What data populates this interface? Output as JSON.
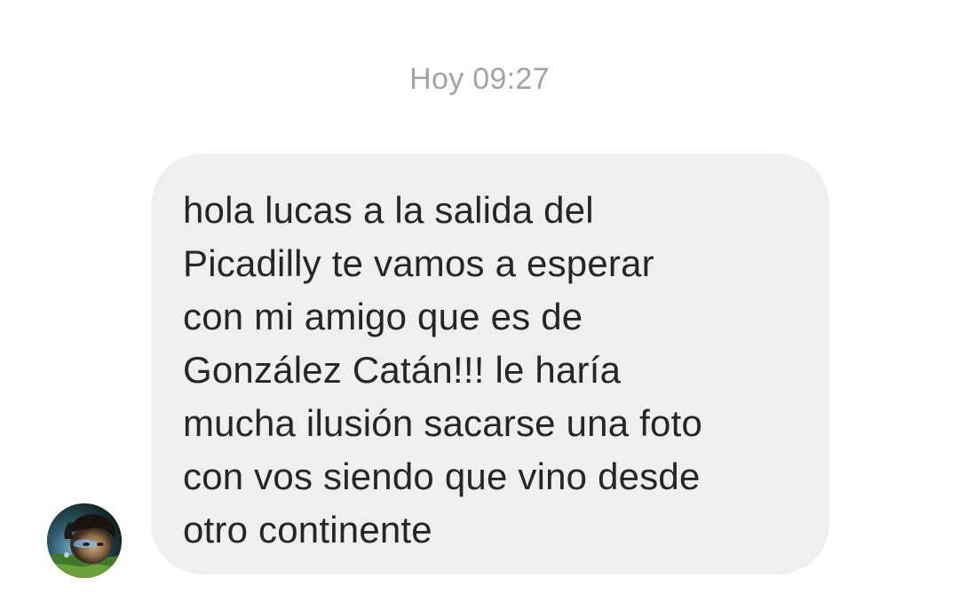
{
  "chat": {
    "timestamp": "Hoy 09:27",
    "message": {
      "lines": [
        "hola lucas a la salida del",
        "Picadilly te vamos a esperar",
        "con mi amigo que es de",
        "González Catán!!! le haría",
        "mucha ilusión sacarse una foto",
        "con vos siendo que vino desde",
        "otro continente"
      ],
      "bubble_color": "#efefef",
      "text_color": "#262626"
    },
    "sender_avatar": {
      "icon": "profile-photo"
    },
    "timestamp_color": "#a3a3a3"
  }
}
